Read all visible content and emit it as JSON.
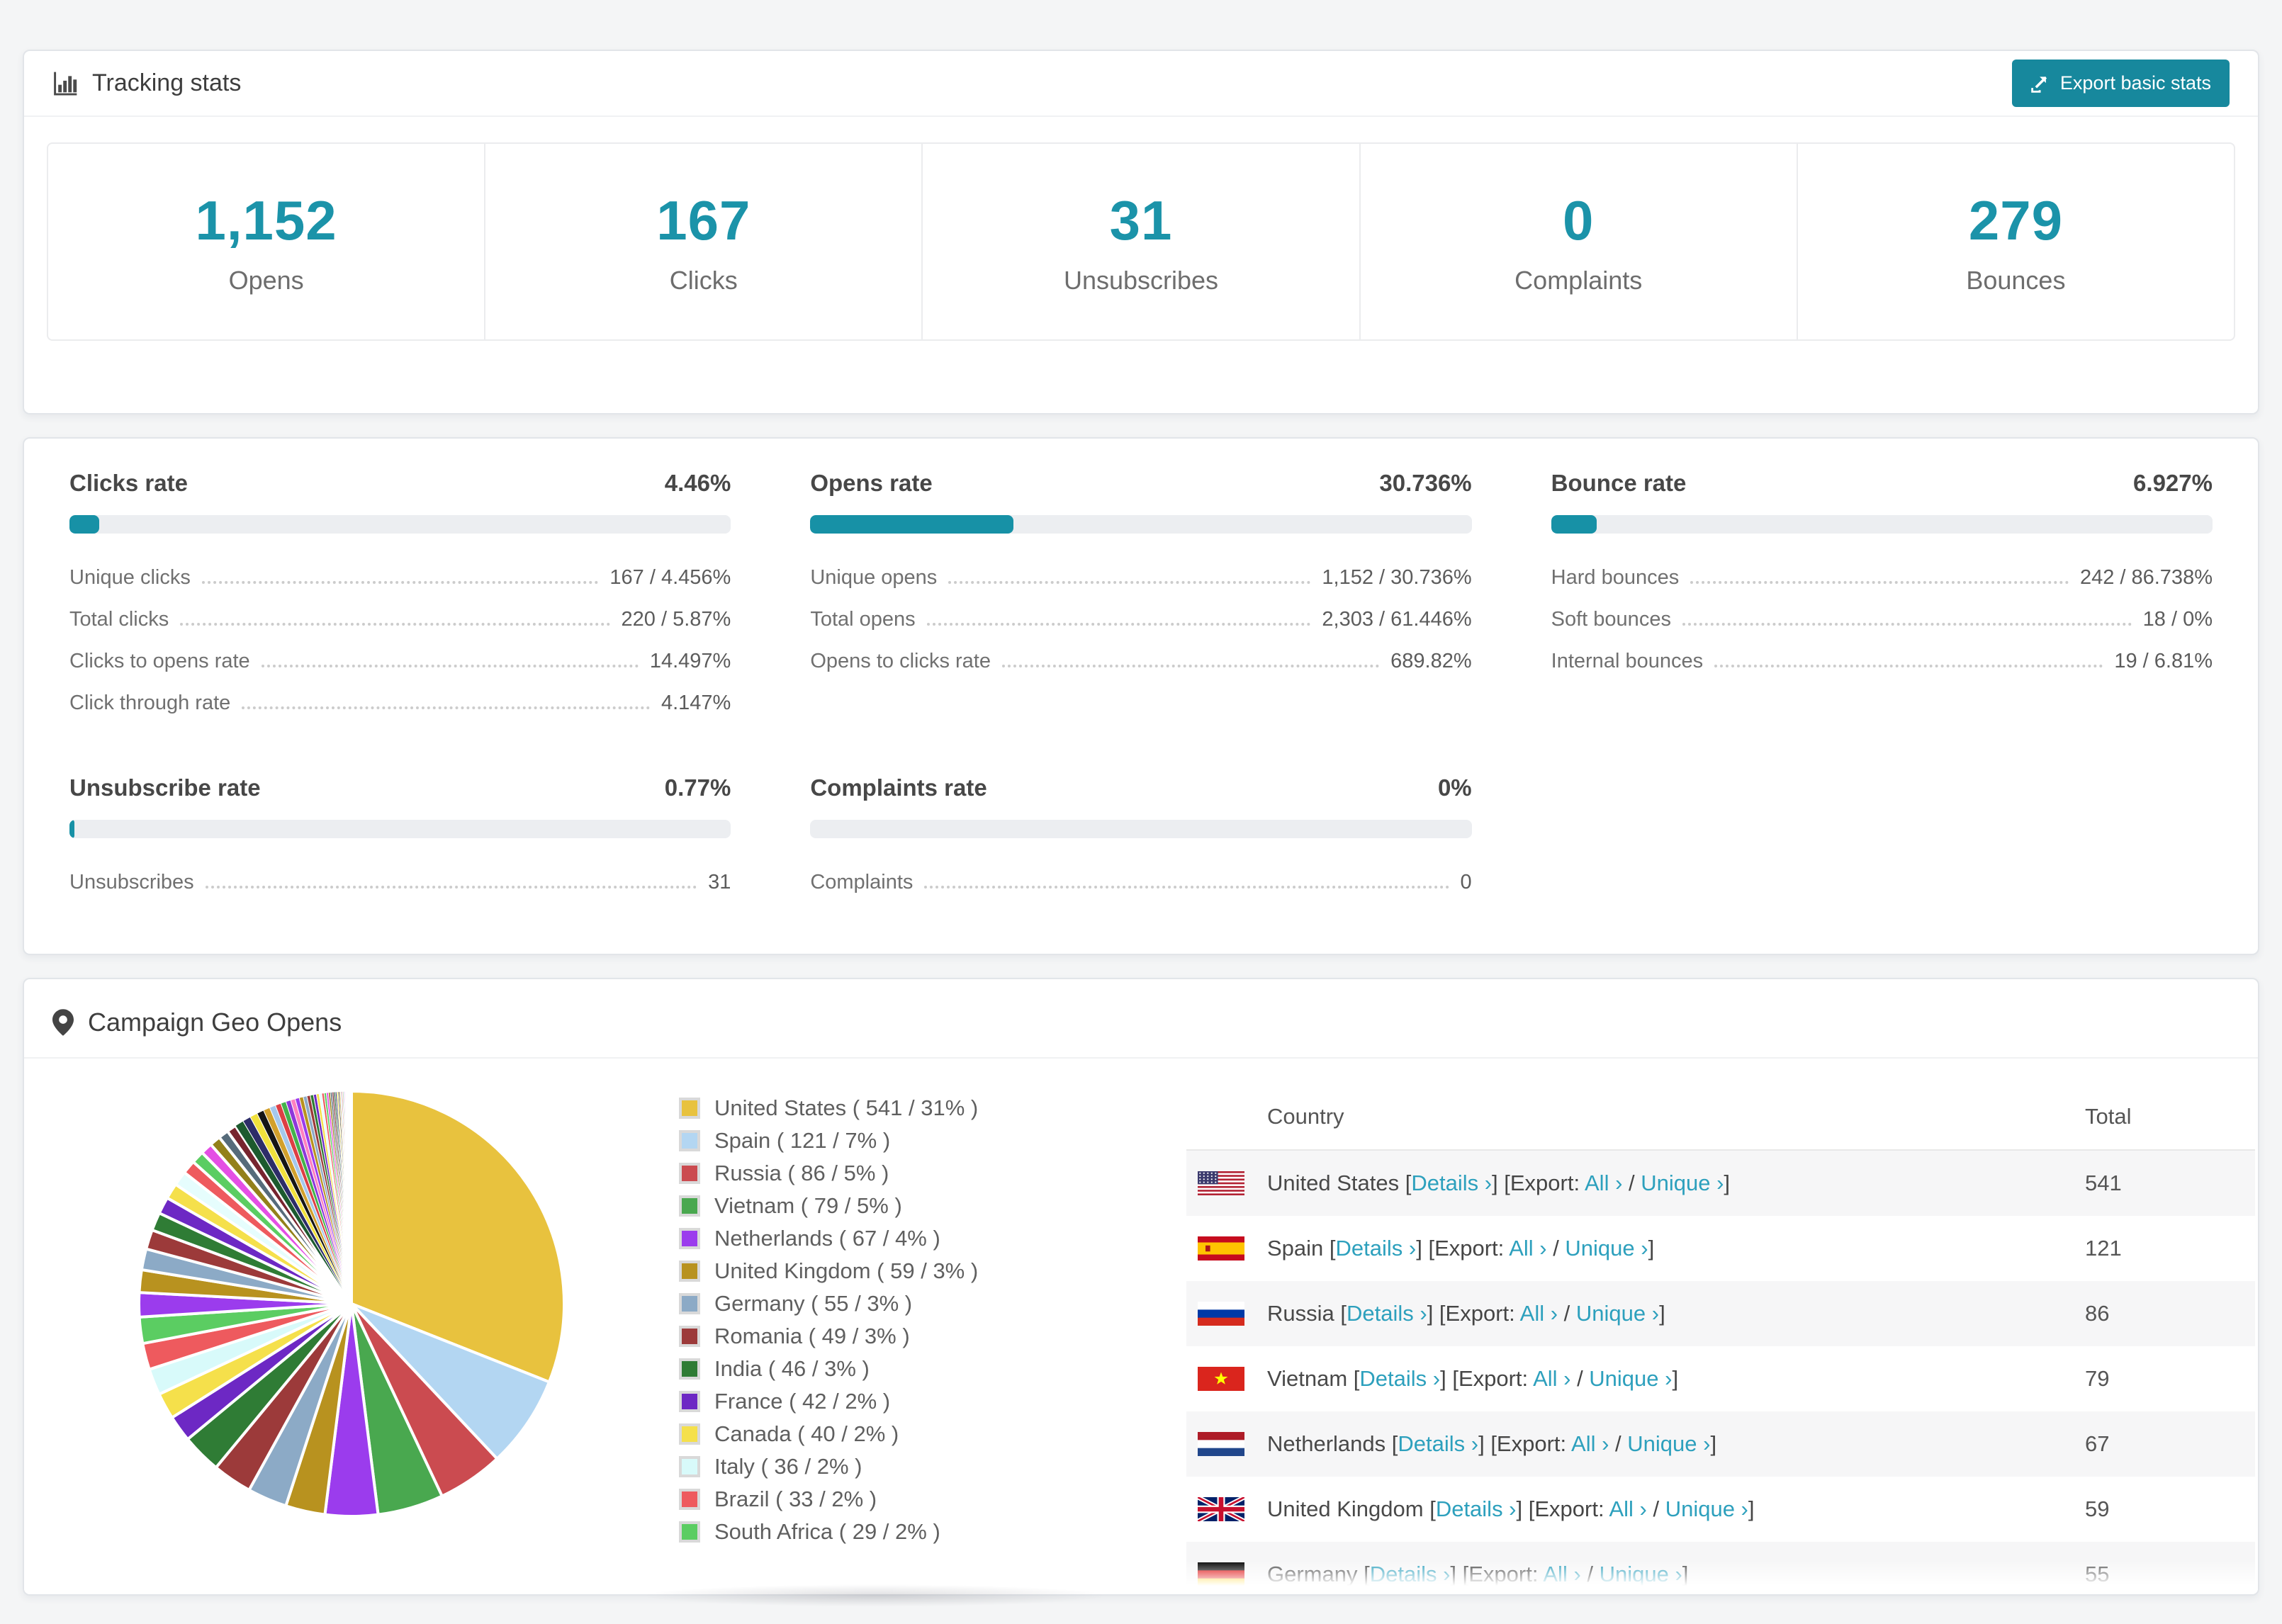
{
  "accent": "#1791a6",
  "header": {
    "title": "Tracking stats",
    "export_label": "Export basic stats"
  },
  "overview": [
    {
      "value": "1,152",
      "label": "Opens"
    },
    {
      "value": "167",
      "label": "Clicks"
    },
    {
      "value": "31",
      "label": "Unsubscribes"
    },
    {
      "value": "0",
      "label": "Complaints"
    },
    {
      "value": "279",
      "label": "Bounces"
    }
  ],
  "rates": [
    {
      "title": "Clicks rate",
      "value": "4.46%",
      "pct": 4.46,
      "rows": [
        [
          "Unique clicks",
          "167 / 4.456%"
        ],
        [
          "Total clicks",
          "220 / 5.87%"
        ],
        [
          "Clicks to opens rate",
          "14.497%"
        ],
        [
          "Click through rate",
          "4.147%"
        ]
      ]
    },
    {
      "title": "Opens rate",
      "value": "30.736%",
      "pct": 30.736,
      "rows": [
        [
          "Unique opens",
          "1,152 / 30.736%"
        ],
        [
          "Total opens",
          "2,303 / 61.446%"
        ],
        [
          "Opens to clicks rate",
          "689.82%"
        ]
      ]
    },
    {
      "title": "Bounce rate",
      "value": "6.927%",
      "pct": 6.927,
      "rows": [
        [
          "Hard bounces",
          "242 / 86.738%"
        ],
        [
          "Soft bounces",
          "18 / 0%"
        ],
        [
          "Internal bounces",
          "19 / 6.81%"
        ]
      ]
    },
    {
      "title": "Unsubscribe rate",
      "value": "0.77%",
      "pct": 0.77,
      "rows": [
        [
          "Unsubscribes",
          "31"
        ]
      ]
    },
    {
      "title": "Complaints rate",
      "value": "0%",
      "pct": 0,
      "rows": [
        [
          "Complaints",
          "0"
        ]
      ]
    }
  ],
  "geo": {
    "title": "Campaign Geo Opens",
    "table": {
      "columns": [
        "Country",
        "Total"
      ],
      "link_labels": {
        "open": "[",
        "close": "]",
        "details": "Details",
        "export_prefix": "Export:",
        "all": "All",
        "separator": "/",
        "unique": "Unique",
        "arrow": "›"
      },
      "rows": [
        {
          "country": "United States",
          "flag": "us",
          "total": 541
        },
        {
          "country": "Spain",
          "flag": "es",
          "total": 121
        },
        {
          "country": "Russia",
          "flag": "ru",
          "total": 86
        },
        {
          "country": "Vietnam",
          "flag": "vn",
          "total": 79
        },
        {
          "country": "Netherlands",
          "flag": "nl",
          "total": 67
        },
        {
          "country": "United Kingdom",
          "flag": "gb",
          "total": 59
        },
        {
          "country": "Germany",
          "flag": "de",
          "total": 55
        }
      ]
    }
  },
  "chart_data": {
    "type": "pie",
    "title": "Campaign Geo Opens",
    "legend_position": "right",
    "start_angle_deg": -90,
    "direction": "clockwise",
    "series": [
      {
        "name": "United States",
        "value": 541,
        "pct": 31,
        "color": "#e8c23e",
        "legend_label": "United States ( 541 / 31% )"
      },
      {
        "name": "Spain",
        "value": 121,
        "pct": 7,
        "color": "#b3d6f2",
        "legend_label": "Spain ( 121 / 7% )"
      },
      {
        "name": "Russia",
        "value": 86,
        "pct": 5,
        "color": "#cb4b50",
        "legend_label": "Russia ( 86 / 5% )"
      },
      {
        "name": "Vietnam",
        "value": 79,
        "pct": 5,
        "color": "#49a84f",
        "legend_label": "Vietnam ( 79 / 5% )"
      },
      {
        "name": "Netherlands",
        "value": 67,
        "pct": 4,
        "color": "#9b3ced",
        "legend_label": "Netherlands ( 67 / 4% )"
      },
      {
        "name": "United Kingdom",
        "value": 59,
        "pct": 3,
        "color": "#b8921f",
        "legend_label": "United Kingdom ( 59 / 3% )"
      },
      {
        "name": "Germany",
        "value": 55,
        "pct": 3,
        "color": "#8caac6",
        "legend_label": "Germany ( 55 / 3% )"
      },
      {
        "name": "Romania",
        "value": 49,
        "pct": 3,
        "color": "#9c3a3a",
        "legend_label": "Romania ( 49 / 3% )"
      },
      {
        "name": "India",
        "value": 46,
        "pct": 3,
        "color": "#2f7c35",
        "legend_label": "India ( 46 / 3% )"
      },
      {
        "name": "France",
        "value": 42,
        "pct": 2,
        "color": "#6d28c4",
        "legend_label": "France ( 42 / 2% )"
      },
      {
        "name": "Canada",
        "value": 40,
        "pct": 2,
        "color": "#f5e04b",
        "legend_label": "Canada ( 40 / 2% )"
      },
      {
        "name": "Italy",
        "value": 36,
        "pct": 2,
        "color": "#d8fafa",
        "legend_label": "Italy ( 36 / 2% )"
      },
      {
        "name": "Brazil",
        "value": 33,
        "pct": 2,
        "color": "#ee5a5e",
        "legend_label": "Brazil ( 33 / 2% )"
      },
      {
        "name": "South Africa",
        "value": 29,
        "pct": 2,
        "color": "#5bcd62",
        "legend_label": "South Africa ( 29 / 2% )"
      }
    ],
    "others": {
      "note": "remaining unlabeled small countries",
      "count": 60,
      "first_pct": 1.9,
      "ratio": 0.93,
      "total_pct": 26,
      "palette": [
        "#9b3ced",
        "#b8921f",
        "#8caac6",
        "#9c3a3a",
        "#2f7c35",
        "#6d28c4",
        "#f5e04b",
        "#e6fdfd",
        "#ee5a5e",
        "#5bcd62",
        "#e44fe4",
        "#93801a",
        "#566b7a",
        "#77242e",
        "#1c5a2e",
        "#2d2d68",
        "#f1e13c",
        "#151515",
        "#d2a02c",
        "#a5c8ec",
        "#dd3f44",
        "#44b24b",
        "#8d38da",
        "#ff80c0"
      ]
    }
  }
}
